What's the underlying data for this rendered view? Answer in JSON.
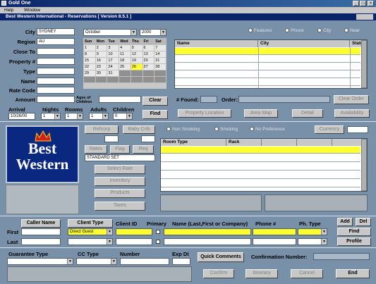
{
  "titlebar": {
    "app": "Gold One",
    "controls": [
      "_",
      "□",
      "×"
    ]
  },
  "menu": [
    "Help",
    "Window"
  ],
  "subtitle": "Best Western International - Reservations [ Version 8.5.1 ]",
  "search": {
    "city_label": "City",
    "city_value": "SYDNEY",
    "region_label": "Region",
    "region_value": "AU",
    "close_to_label": "Close To",
    "property_label": "Property #",
    "type_label": "Type",
    "name_label": "Name",
    "rate_code_label": "Rate Code",
    "amount_label": "Amount",
    "ages_label": "Ages of Children",
    "clear": "Clear",
    "find": "Find",
    "arrival_label": "Arrival",
    "arrival_value": "10/26/00",
    "nights_label": "Nights",
    "nights_value": "1",
    "rooms_label": "Rooms",
    "rooms_value": "1",
    "adults_label": "Adults",
    "adults_value": "1",
    "children_label": "Children",
    "children_value": "0"
  },
  "calendar": {
    "month": "October",
    "year": "2000",
    "days": [
      "Sun",
      "Mon",
      "Tue",
      "Wed",
      "Thu",
      "Fri",
      "Sat"
    ],
    "weeks": [
      [
        "1",
        "2",
        "3",
        "4",
        "5",
        "6",
        "7"
      ],
      [
        "8",
        "9",
        "10",
        "11",
        "12",
        "13",
        "14"
      ],
      [
        "15",
        "16",
        "17",
        "18",
        "19",
        "20",
        "21"
      ],
      [
        "22",
        "23",
        "24",
        "25",
        "26",
        "27",
        "28"
      ],
      [
        "29",
        "30",
        "31",
        "",
        "",
        "",
        ""
      ],
      [
        "",
        "",
        "",
        "",
        "",
        "",
        ""
      ]
    ],
    "highlight": "26"
  },
  "filters": [
    "Features",
    "Phone",
    "City",
    "Near"
  ],
  "results": {
    "columns": [
      "Name",
      "City",
      "State"
    ],
    "found_label": "# Found:",
    "order_label": "Order:",
    "clear_order": "Clear Order"
  },
  "result_buttons": [
    "Property Location",
    "Area Map",
    "Detail",
    "Availability"
  ],
  "rate_buttons": {
    "refcorp": "Refcorp",
    "baby_crib": "Baby Crib",
    "rates": "Rates",
    "flag": "Flag",
    "req": "Req",
    "standard": "STANDARD SET",
    "select_rate": "Select Rate",
    "inventory": "Inventory",
    "products": "Products",
    "taxes": "Taxes"
  },
  "smoking": [
    "Non Smoking",
    "Smoking",
    "No Preference"
  ],
  "currency": "Currency",
  "room": {
    "columns": [
      "Room Type",
      "Rack",
      "",
      "",
      ""
    ]
  },
  "logo": {
    "line1": "Best",
    "line2": "Western"
  },
  "caller": {
    "caller_name": "Caller Name",
    "client_type": "Client Type",
    "client_type_value": "Direct Guest",
    "client_id": "Client ID",
    "primary": "Primary",
    "name": "Name (Last,First or Company)",
    "phone": "Phone #",
    "ph_type": "Ph. Type",
    "first": "First",
    "last": "Last",
    "add": "Add",
    "del": "Del",
    "find": "Find",
    "profile": "Profile"
  },
  "guarantee": {
    "guarantee_type": "Guarantee Type",
    "cc_type": "CC Type",
    "number": "Number",
    "exp_dt": "Exp Dt",
    "quick_comments": "Quick Comments",
    "confirmation": "Confirmation Number:"
  },
  "bottom_buttons": [
    "Confirm",
    "Itinerary",
    "Cancel",
    "End"
  ],
  "colors": {
    "title": "#0a246a",
    "yellow": "#ffff30",
    "bg": "#7890a8"
  }
}
